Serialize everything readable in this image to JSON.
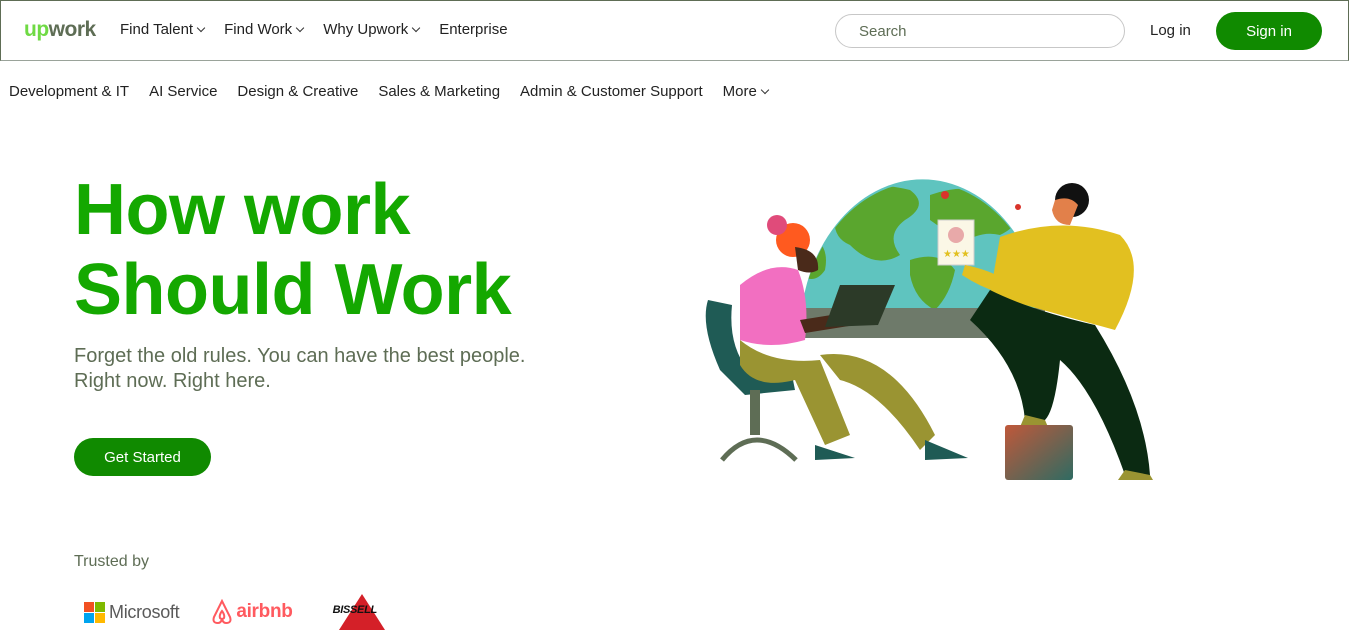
{
  "brand": {
    "logo_up": "up",
    "logo_work": "work"
  },
  "top_nav": [
    {
      "label": "Find Talent",
      "dropdown": true
    },
    {
      "label": "Find Work",
      "dropdown": true
    },
    {
      "label": "Why Upwork",
      "dropdown": true
    },
    {
      "label": "Enterprise",
      "dropdown": false
    }
  ],
  "search": {
    "placeholder": "Search"
  },
  "auth": {
    "login": "Log in",
    "signin": "Sign in"
  },
  "category_nav": [
    {
      "label": "Development & IT"
    },
    {
      "label": "AI Service"
    },
    {
      "label": "Design & Creative"
    },
    {
      "label": "Sales & Marketing"
    },
    {
      "label": "Admin & Customer Support"
    },
    {
      "label": "More",
      "dropdown": true
    }
  ],
  "hero": {
    "title_line1": "How work",
    "title_line2": "Should Work",
    "subtitle_line1": "Forget the old rules. You can have the best people.",
    "subtitle_line2": "Right now. Right here.",
    "cta": "Get Started"
  },
  "trusted": {
    "label": "Trusted by",
    "logos": [
      {
        "name": "Microsoft",
        "text": "Microsoft"
      },
      {
        "name": "airbnb",
        "text": "airbnb"
      },
      {
        "name": "Bissell",
        "text": "BISSELL"
      }
    ]
  },
  "colors": {
    "brand_green": "#14a800",
    "button_green": "#108a00",
    "logo_green": "#6fda44",
    "text_gray": "#5e6d55"
  }
}
